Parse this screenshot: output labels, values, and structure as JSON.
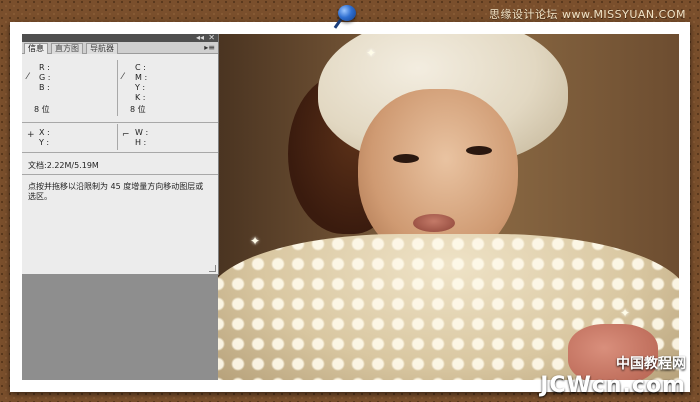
{
  "watermark_top": "思缘设计论坛 www.MISSYUAN.COM",
  "panel": {
    "controls": {
      "collapse": "◂◂",
      "close": "✕",
      "menu": "▸≡"
    },
    "tabs": [
      {
        "label": "信息",
        "active": true
      },
      {
        "label": "直方图",
        "active": false
      },
      {
        "label": "导航器",
        "active": false
      }
    ],
    "rgb": {
      "r": "R :",
      "g": "G :",
      "b": "B :",
      "bits": "8 位"
    },
    "cmyk": {
      "c": "C :",
      "m": "M :",
      "y": "Y :",
      "k": "K :",
      "bits": "8 位"
    },
    "xy": {
      "x": "X :",
      "y": "Y :"
    },
    "wh": {
      "w": "W :",
      "h": "H :"
    },
    "doc": "文档:2.22M/5.19M",
    "hint": "点按并拖移以沿限制为 45 度增量方向移动图层或选区。"
  },
  "brand": {
    "cn": "中国教程网",
    "en": "JCWcn.com"
  }
}
